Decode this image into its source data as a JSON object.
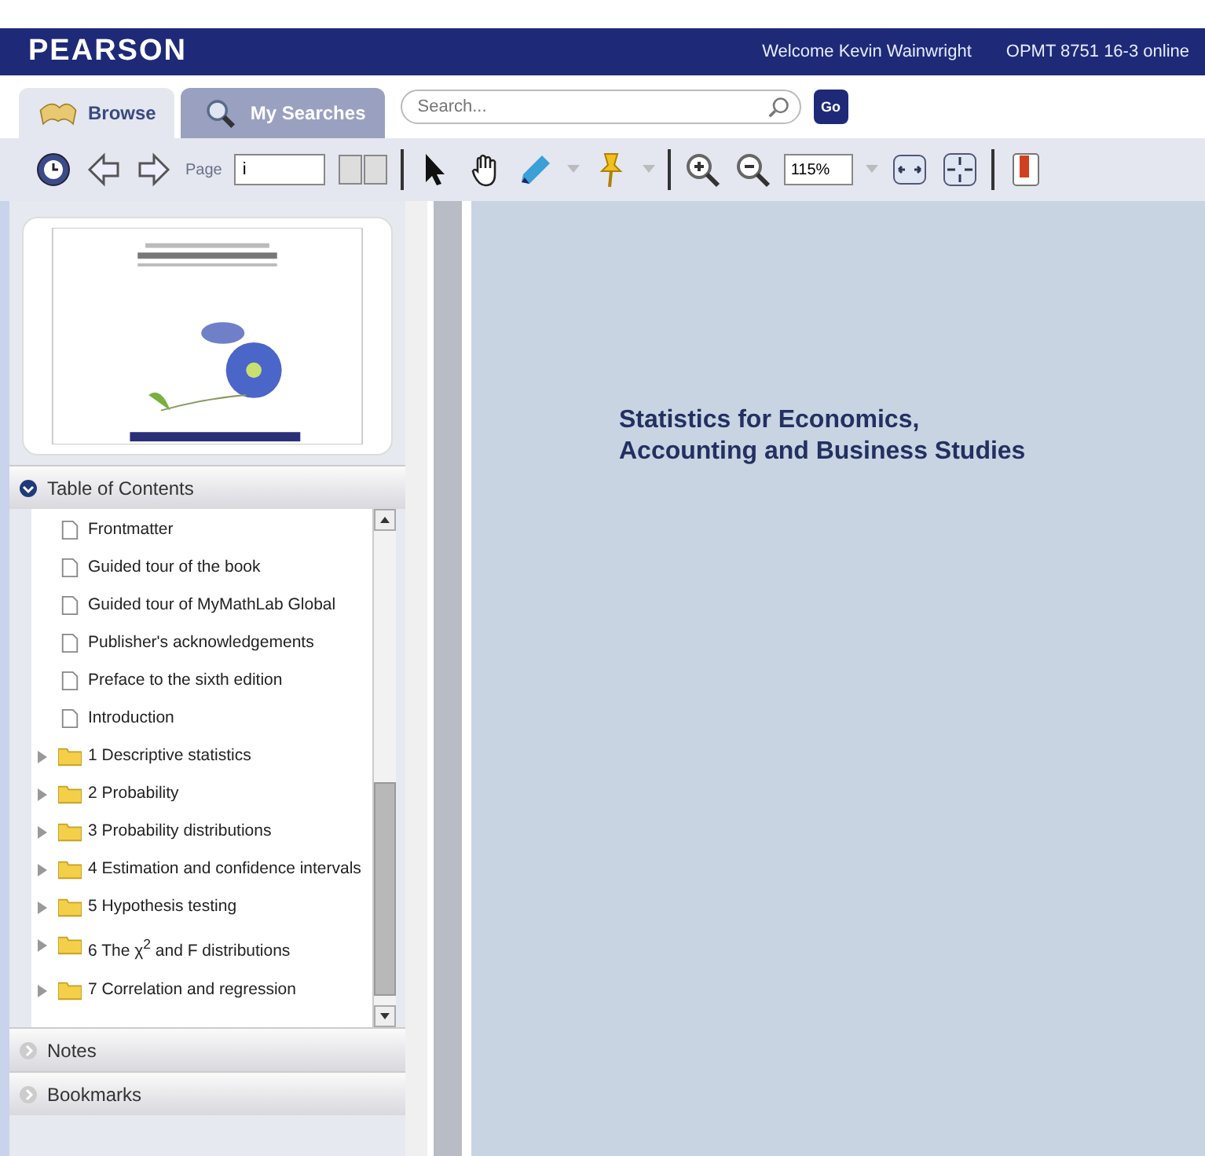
{
  "header": {
    "logo": "PEARSON",
    "welcome": "Welcome Kevin Wainwright",
    "course": "OPMT 8751 16-3 online"
  },
  "tabs": [
    {
      "label": "Browse",
      "selected": true,
      "kind": "book"
    },
    {
      "label": "My Searches",
      "selected": false,
      "kind": "search"
    }
  ],
  "search": {
    "placeholder": "Search...",
    "button": "Go"
  },
  "toolbar": {
    "page_label": "Page",
    "page_value": "i",
    "zoom_value": "115%"
  },
  "sections": [
    {
      "title": "Table of Contents",
      "expanded": true
    },
    {
      "title": "Notes",
      "expanded": false
    },
    {
      "title": "Bookmarks",
      "expanded": false
    }
  ],
  "toc": [
    {
      "label": "Frontmatter",
      "kind": "doc"
    },
    {
      "label": "Guided tour of the book",
      "kind": "doc"
    },
    {
      "label": "Guided tour of MyMathLab Global",
      "kind": "doc"
    },
    {
      "label": "Publisher's acknowledgements",
      "kind": "doc"
    },
    {
      "label": "Preface to the sixth edition",
      "kind": "doc"
    },
    {
      "label": "Introduction",
      "kind": "doc"
    },
    {
      "label": "1 Descriptive statistics",
      "kind": "folder",
      "expanded": false
    },
    {
      "label": "2 Probability",
      "kind": "folder",
      "expanded": false
    },
    {
      "label": "3 Probability distributions",
      "kind": "folder",
      "expanded": false
    },
    {
      "label": "4 Estimation and confidence intervals",
      "kind": "folder",
      "expanded": false
    },
    {
      "label": "5 Hypothesis testing",
      "kind": "folder",
      "expanded": false
    },
    {
      "label": "6 The χ$^{2}$ and F distributions",
      "kind": "folder",
      "expanded": false
    },
    {
      "label": "7 Correlation and regression",
      "kind": "folder",
      "expanded": false
    }
  ],
  "document": {
    "title_lines": [
      "Statistics for Economics,",
      "Accounting and Business Studies"
    ]
  }
}
